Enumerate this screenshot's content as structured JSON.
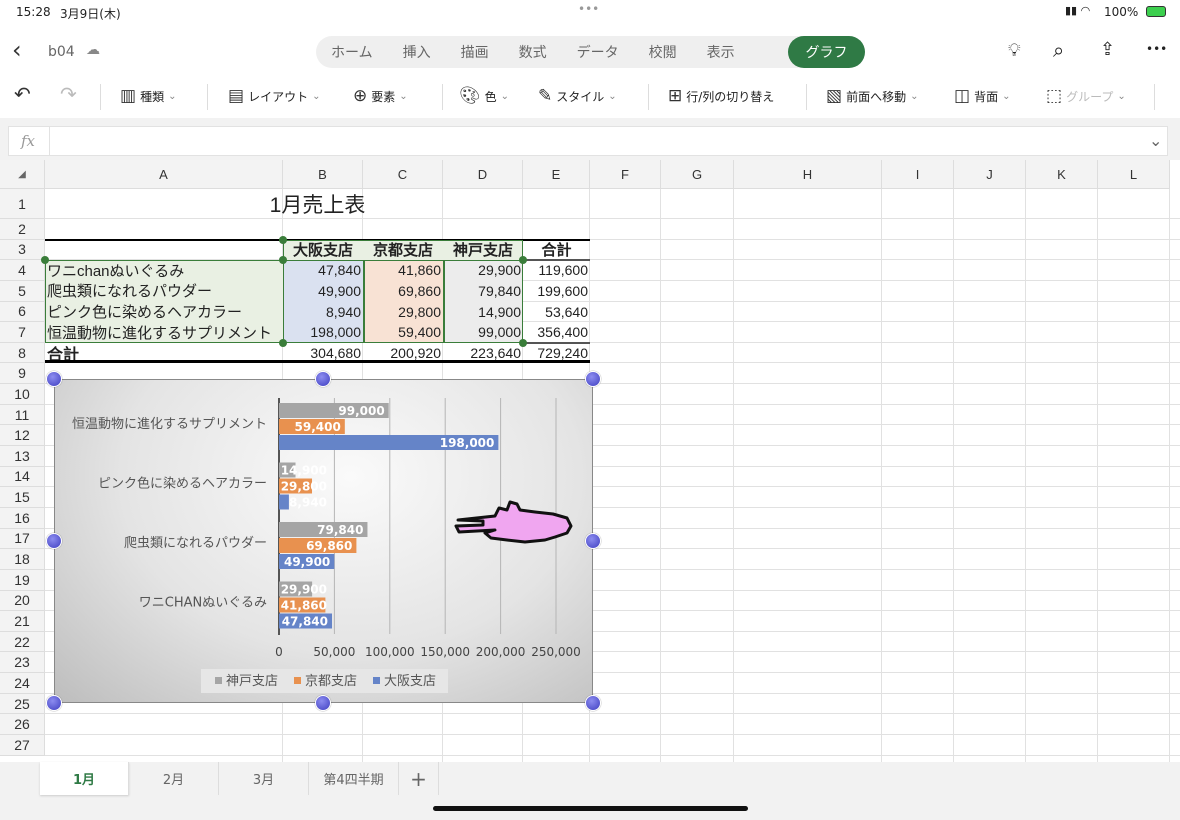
{
  "status": {
    "time": "15:28",
    "date": "3月9日(木)",
    "battery": "100%",
    "dots": "•••"
  },
  "topbar": {
    "filename": "b04",
    "tabs": [
      "ホーム",
      "挿入",
      "描画",
      "数式",
      "データ",
      "校閲",
      "表示"
    ],
    "active_tab": "グラフ",
    "more": "•••"
  },
  "ribbon": {
    "items": [
      {
        "icon": "chart-type-icon",
        "label": "種類",
        "dd": true
      },
      {
        "icon": "layout-icon",
        "label": "レイアウト",
        "dd": true
      },
      {
        "icon": "elements-icon",
        "label": "要素",
        "dd": true
      },
      {
        "icon": "palette-icon",
        "label": "色",
        "dd": true
      },
      {
        "icon": "style-icon",
        "label": "スタイル",
        "dd": true
      },
      {
        "icon": "switch-row-col-icon",
        "label": "行/列の切り替え",
        "dd": false
      },
      {
        "icon": "bring-forward-icon",
        "label": "前面へ移動",
        "dd": true
      },
      {
        "icon": "send-backward-icon",
        "label": "背面",
        "dd": true
      },
      {
        "icon": "group-icon",
        "label": "グループ",
        "dd": true,
        "disabled": true
      }
    ]
  },
  "formula": {
    "fx": "fx",
    "value": ""
  },
  "sheet": {
    "columns": [
      "A",
      "B",
      "C",
      "D",
      "E",
      "F",
      "G",
      "H",
      "I",
      "J",
      "K",
      "L"
    ],
    "row_numbers": [
      "1",
      "2",
      "3",
      "4",
      "5",
      "6",
      "7",
      "8",
      "9",
      "10",
      "11",
      "12",
      "13",
      "14",
      "15",
      "16",
      "17",
      "18",
      "19",
      "20",
      "21",
      "22",
      "23",
      "24",
      "25",
      "26",
      "27"
    ],
    "title": "1月売上表",
    "header": [
      "",
      "大阪支店",
      "京都支店",
      "神戸支店",
      "合計"
    ],
    "rows": [
      [
        "ワニchanぬいぐるみ",
        "47,840",
        "41,860",
        "29,900",
        "119,600"
      ],
      [
        "爬虫類になれるパウダー",
        "49,900",
        "69,860",
        "79,840",
        "199,600"
      ],
      [
        "ピンク色に染めるヘアカラー",
        "8,940",
        "29,800",
        "14,900",
        "53,640"
      ],
      [
        "恒温動物に進化するサプリメント",
        "198,000",
        "59,400",
        "99,000",
        "356,400"
      ]
    ],
    "total": [
      "合計",
      "304,680",
      "200,920",
      "223,640",
      "729,240"
    ]
  },
  "chart_data": {
    "type": "bar",
    "orientation": "horizontal",
    "categories": [
      "恒温動物に進化するサプリメント",
      "ピンク色に染めるヘアカラー",
      "爬虫類になれるパウダー",
      "ワニCHANぬいぐるみ"
    ],
    "series": [
      {
        "name": "神戸支店",
        "color": "#a5a5a5",
        "values": [
          99000,
          14900,
          79840,
          29900
        ],
        "labels": [
          "99,000",
          "14,900",
          "79,840",
          "29,900"
        ]
      },
      {
        "name": "京都支店",
        "color": "#e8914f",
        "values": [
          59400,
          29800,
          69860,
          41860
        ],
        "labels": [
          "59,400",
          "29,800",
          "69,860",
          "41,860"
        ]
      },
      {
        "name": "大阪支店",
        "color": "#6584c8",
        "values": [
          198000,
          8940,
          49900,
          47840
        ],
        "labels": [
          "198,000",
          "8,940",
          "49,900",
          "47,840"
        ]
      }
    ],
    "xlim": [
      0,
      250000
    ],
    "ticks": [
      "0",
      "50,000",
      "100,000",
      "150,000",
      "200,000",
      "250,000"
    ],
    "grid": true,
    "legend": "bottom"
  },
  "sheet_tabs": [
    "1月",
    "2月",
    "3月",
    "第4四半期"
  ],
  "add_sheet": "+"
}
